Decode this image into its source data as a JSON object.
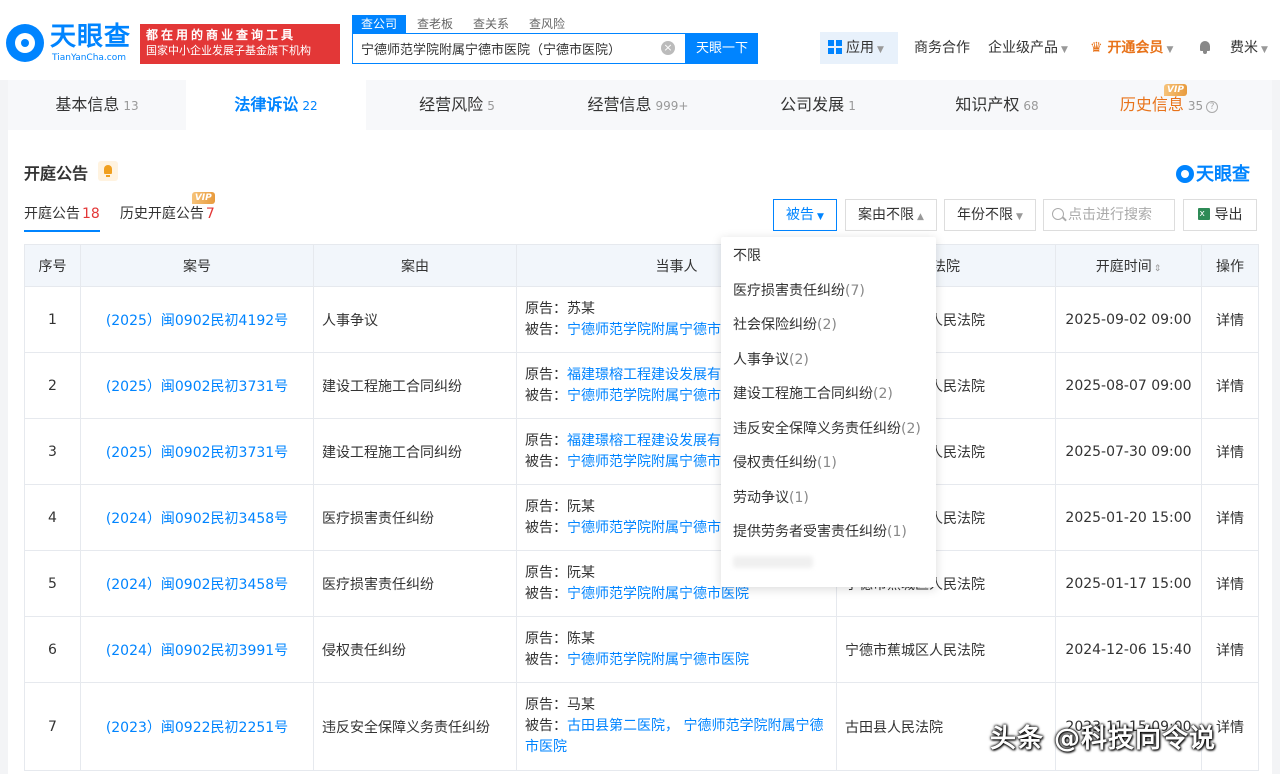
{
  "header": {
    "logo_text": "天眼查",
    "logo_sub": "TianYanCha.com",
    "promo_line1": "都在用的商业查询工具",
    "promo_line2": "国家中小企业发展子基金旗下机构",
    "search_tabs": [
      "查公司",
      "查老板",
      "查关系",
      "查风险"
    ],
    "search_value": "宁德师范学院附属宁德市医院（宁德市医院）",
    "search_button": "天眼一下",
    "nav_apps": "应用",
    "nav_biz": "商务合作",
    "nav_enterprise": "企业级产品",
    "nav_vip": "开通会员",
    "nav_user": "费米"
  },
  "main_tabs": [
    {
      "label": "基本信息",
      "count": "13"
    },
    {
      "label": "法律诉讼",
      "count": "22"
    },
    {
      "label": "经营风险",
      "count": "5"
    },
    {
      "label": "经营信息",
      "count": "999+"
    },
    {
      "label": "公司发展",
      "count": "1"
    },
    {
      "label": "知识产权",
      "count": "68"
    },
    {
      "label": "历史信息",
      "count": "35",
      "badge": "VIP"
    }
  ],
  "section": {
    "title": "开庭公告",
    "brand": "天眼查",
    "sub_tabs": [
      {
        "label": "开庭公告",
        "count": "18"
      },
      {
        "label": "历史开庭公告",
        "count": "7",
        "badge": "VIP"
      }
    ]
  },
  "filters": {
    "defendant": "被告",
    "cause": "案由不限",
    "year": "年份不限",
    "search_placeholder": "点击进行搜索",
    "export": "导出"
  },
  "table": {
    "headers": [
      "序号",
      "案号",
      "案由",
      "当事人",
      "法院",
      "开庭时间",
      "操作"
    ],
    "rows": [
      {
        "no": "1",
        "case": "(2025）闽0902民初4192号",
        "cause": "人事争议",
        "plaintiff": "苏某",
        "defendant": "宁德师范学院附属宁德市医院",
        "court": "宁德市蕉城区人民法院",
        "time": "2025-09-02 09:00",
        "action": "详情"
      },
      {
        "no": "2",
        "case": "(2025）闽0902民初3731号",
        "cause": "建设工程施工合同纠纷",
        "plaintiff": "福建璟榕工程建设发展有限公司",
        "defendant": "宁德师范学院附属宁德市医院",
        "court": "宁德市蕉城区人民法院",
        "time": "2025-08-07 09:00",
        "action": "详情"
      },
      {
        "no": "3",
        "case": "(2025）闽0902民初3731号",
        "cause": "建设工程施工合同纠纷",
        "plaintiff": "福建璟榕工程建设发展有限公司",
        "defendant": "宁德师范学院附属宁德市医院",
        "court": "宁德市蕉城区人民法院",
        "time": "2025-07-30 09:00",
        "action": "详情"
      },
      {
        "no": "4",
        "case": "(2024）闽0902民初3458号",
        "cause": "医疗损害责任纠纷",
        "plaintiff": "阮某",
        "defendant": "宁德师范学院附属宁德市医院",
        "court": "宁德市蕉城区人民法院",
        "time": "2025-01-20 15:00",
        "action": "详情"
      },
      {
        "no": "5",
        "case": "(2024）闽0902民初3458号",
        "cause": "医疗损害责任纠纷",
        "plaintiff": "阮某",
        "defendant": "宁德师范学院附属宁德市医院",
        "court": "宁德市蕉城区人民法院",
        "time": "2025-01-17 15:00",
        "action": "详情"
      },
      {
        "no": "6",
        "case": "(2024）闽0902民初3991号",
        "cause": "侵权责任纠纷",
        "plaintiff": "陈某",
        "defendant": "宁德师范学院附属宁德市医院",
        "court": "宁德市蕉城区人民法院",
        "time": "2024-12-06 15:40",
        "action": "详情"
      },
      {
        "no": "7",
        "case": "(2023）闽0922民初2251号",
        "cause": "违反安全保障义务责任纠纷",
        "plaintiff": "马某",
        "defendant": "古田县第二医院， 宁德师范学院附属宁德市医院",
        "court": "古田县人民法院",
        "time": "2023-11-15 09:00",
        "action": "详情"
      }
    ],
    "plaintiff_label": "原告：",
    "defendant_label": "被告："
  },
  "dropdown": {
    "items": [
      {
        "label": "不限",
        "count": ""
      },
      {
        "label": "医疗损害责任纠纷",
        "count": "(7)"
      },
      {
        "label": "社会保险纠纷",
        "count": "(2)"
      },
      {
        "label": "人事争议",
        "count": "(2)"
      },
      {
        "label": "建设工程施工合同纠纷",
        "count": "(2)"
      },
      {
        "label": "违反安全保障义务责任纠纷",
        "count": "(2)"
      },
      {
        "label": "侵权责任纠纷",
        "count": "(1)"
      },
      {
        "label": "劳动争议",
        "count": "(1)"
      },
      {
        "label": "提供劳务者受害责任纠纷",
        "count": "(1)"
      }
    ]
  },
  "watermark": "头条 @科技向令说",
  "colors": {
    "accent": "#0084ff",
    "promo": "#e33737",
    "vip": "#e8731a"
  }
}
